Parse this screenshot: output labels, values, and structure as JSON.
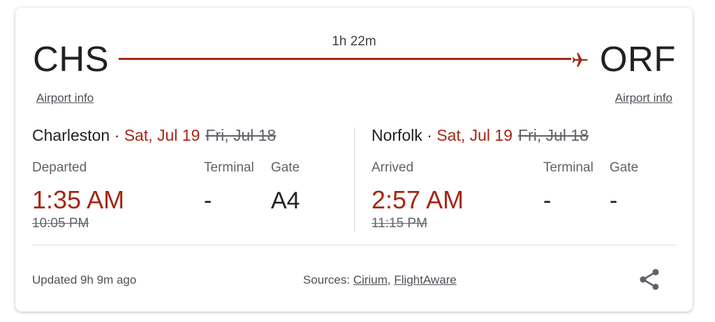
{
  "route": {
    "origin_code": "CHS",
    "destination_code": "ORF",
    "duration": "1h 22m",
    "origin_airport_link": "Airport info",
    "destination_airport_link": "Airport info"
  },
  "departure": {
    "city": "Charleston",
    "separator": " · ",
    "date": "Sat, Jul 19",
    "scheduled_date": "Fri, Jul 18",
    "status_label": "Departed",
    "time": "1:35 AM",
    "scheduled_time": "10:05 PM",
    "terminal_label": "Terminal",
    "terminal": "-",
    "gate_label": "Gate",
    "gate": "A4"
  },
  "arrival": {
    "city": "Norfolk",
    "separator": " · ",
    "date": "Sat, Jul 19",
    "scheduled_date": "Fri, Jul 18",
    "status_label": "Arrived",
    "time": "2:57 AM",
    "scheduled_time": "11:15 PM",
    "terminal_label": "Terminal",
    "terminal": "-",
    "gate_label": "Gate",
    "gate": "-"
  },
  "footer": {
    "updated": "Updated 9h 9m ago",
    "sources_label": "Sources: ",
    "source_1": "Cirium",
    "source_sep": ", ",
    "source_2": "FlightAware"
  },
  "icons": {
    "plane": "airplane-icon",
    "share": "share-icon"
  },
  "colors": {
    "accent": "#a52714",
    "text": "#202124",
    "muted": "#5f6368",
    "divider": "#dadce0"
  }
}
